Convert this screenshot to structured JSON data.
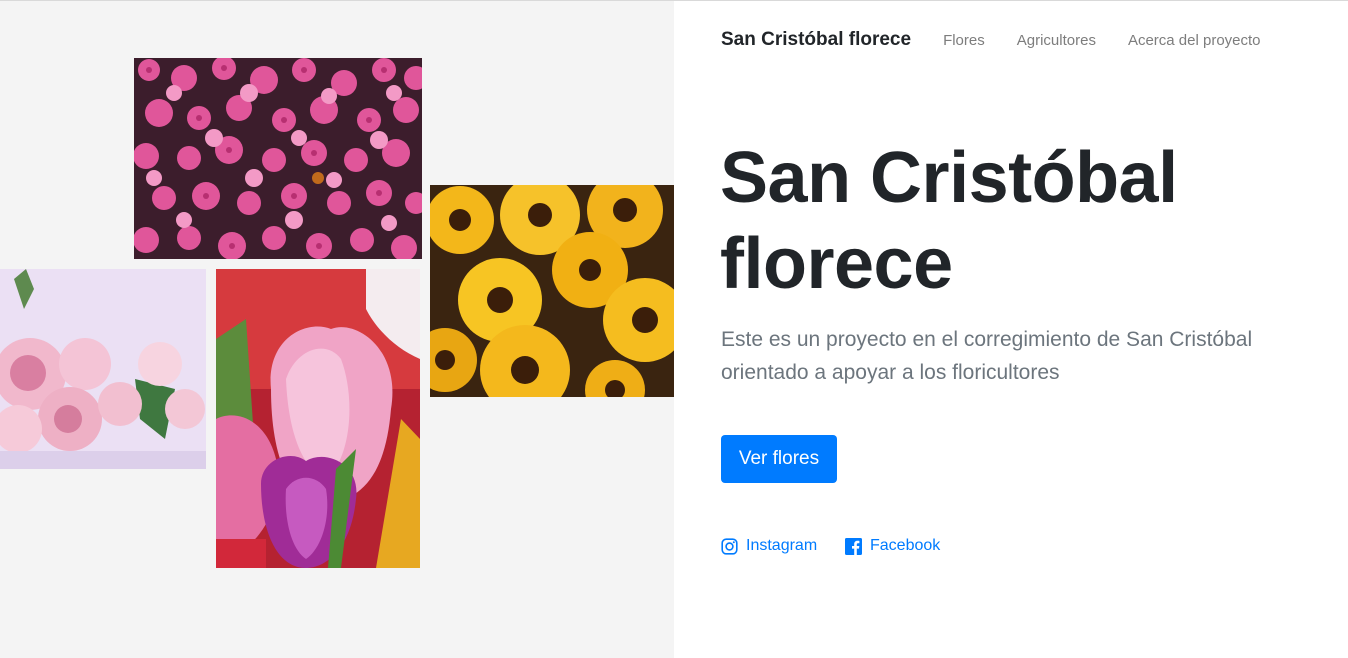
{
  "nav": {
    "brand": "San Cristóbal florece",
    "links": [
      "Flores",
      "Agricultores",
      "Acerca del proyecto"
    ]
  },
  "hero": {
    "title_line1": "San Cristóbal",
    "title_line2": "florece",
    "subtitle": "Este es un proyecto en el corregimiento de San Cristóbal orientado a apoyar a los floricultores",
    "button": "Ver flores"
  },
  "social": {
    "instagram": "Instagram",
    "facebook": "Facebook"
  },
  "gallery": [
    {
      "name": "pink-phlox-photo",
      "subject": "pink flowers"
    },
    {
      "name": "yellow-daisies-photo",
      "subject": "yellow flowers"
    },
    {
      "name": "pink-roses-photo",
      "subject": "pink roses"
    },
    {
      "name": "tulips-photo",
      "subject": "tulips"
    }
  ],
  "colors": {
    "primary": "#007bff",
    "heading": "#212529",
    "muted": "#6c757d",
    "panel_bg": "#f4f4f4"
  }
}
